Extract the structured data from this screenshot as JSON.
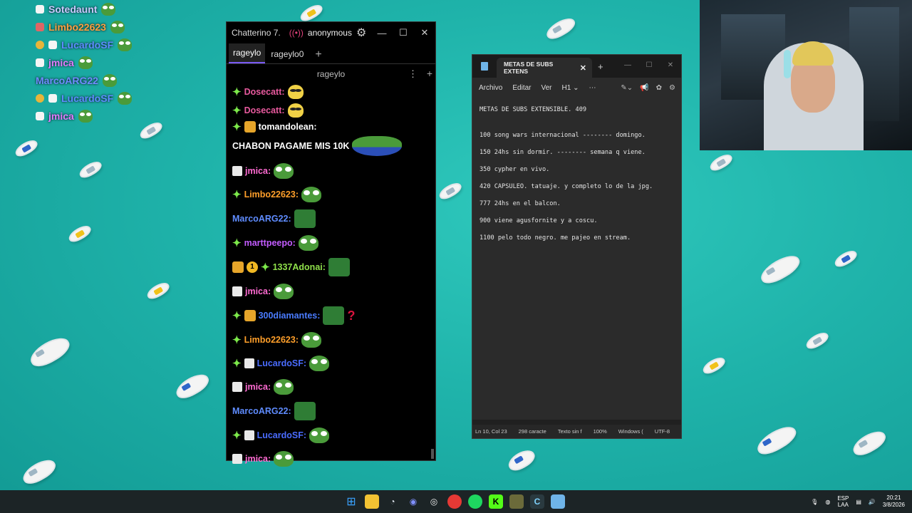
{
  "overlay_chat": [
    {
      "user": "Sotedaunt",
      "color": "#c9c9ff"
    },
    {
      "user": "Limbo22623",
      "color": "#ff9f40"
    },
    {
      "user": "LucardoSF",
      "color": "#5d8cff"
    },
    {
      "user": "jmica",
      "color": "#e27bff"
    },
    {
      "user": "MarcoARG22",
      "color": "#6f8cff"
    },
    {
      "user": "LucardoSF",
      "color": "#5d8cff"
    },
    {
      "user": "jmica",
      "color": "#e27bff"
    }
  ],
  "chatterino": {
    "title": "Chatterino 7.",
    "account": "anonymous",
    "tabs": [
      "rageylo",
      "rageylo0"
    ],
    "channel": "rageylo",
    "messages": [
      {
        "user": "Dosecatt:",
        "color": "#e85a9e"
      },
      {
        "user": "Dosecatt:",
        "color": "#e85a9e"
      },
      {
        "user": "tomandolean:",
        "color": "#ffffff",
        "text": "CHABON PAGAME MIS 10K"
      },
      {
        "user": "jmica:",
        "color": "#ff6bd2"
      },
      {
        "user": "Limbo22623:",
        "color": "#ff9f2a"
      },
      {
        "user": "MarcoARG22:",
        "color": "#5f8cff"
      },
      {
        "user": "marttpeepo:",
        "color": "#c35cff"
      },
      {
        "user": "1337Adonai:",
        "color": "#8fe04a"
      },
      {
        "user": "jmica:",
        "color": "#ff6bd2"
      },
      {
        "user": "300diamantes:",
        "color": "#4a7cff"
      },
      {
        "user": "Limbo22623:",
        "color": "#ff9f2a"
      },
      {
        "user": "LucardoSF:",
        "color": "#4a6cff"
      },
      {
        "user": "jmica:",
        "color": "#ff6bd2"
      },
      {
        "user": "MarcoARG22:",
        "color": "#5f8cff"
      },
      {
        "user": "LucardoSF:",
        "color": "#4a6cff"
      },
      {
        "user": "jmica:",
        "color": "#ff6bd2"
      }
    ]
  },
  "notepad": {
    "tab_title": "METAS DE SUBS EXTENS",
    "menu": [
      "Archivo",
      "Editar",
      "Ver"
    ],
    "heading_level": "H1",
    "lines": [
      "METAS DE SUBS EXTENSIBLE. 409",
      "",
      "100 song wars internacional -------- domingo.",
      "150 24hs sin dormir. -------- semana q viene.",
      "350 cypher en vivo.",
      "420 CAPSULEO. tatuaje. y completo lo de la jpg.",
      "777 24hs en el balcon.",
      "900 viene agusfornite y a coscu.",
      "1100 pelo todo negro. me pajeo en stream."
    ],
    "status": {
      "position": "Ln 10, Col 23",
      "chars": "298 caracte",
      "format": "Texto sin f",
      "zoom": "100%",
      "eol": "Windows (",
      "encoding": "UTF-8"
    }
  },
  "taskbar": {
    "lang_top": "ESP",
    "lang_bottom": "LAA",
    "time": "20:21",
    "date": "3/8/2026"
  }
}
